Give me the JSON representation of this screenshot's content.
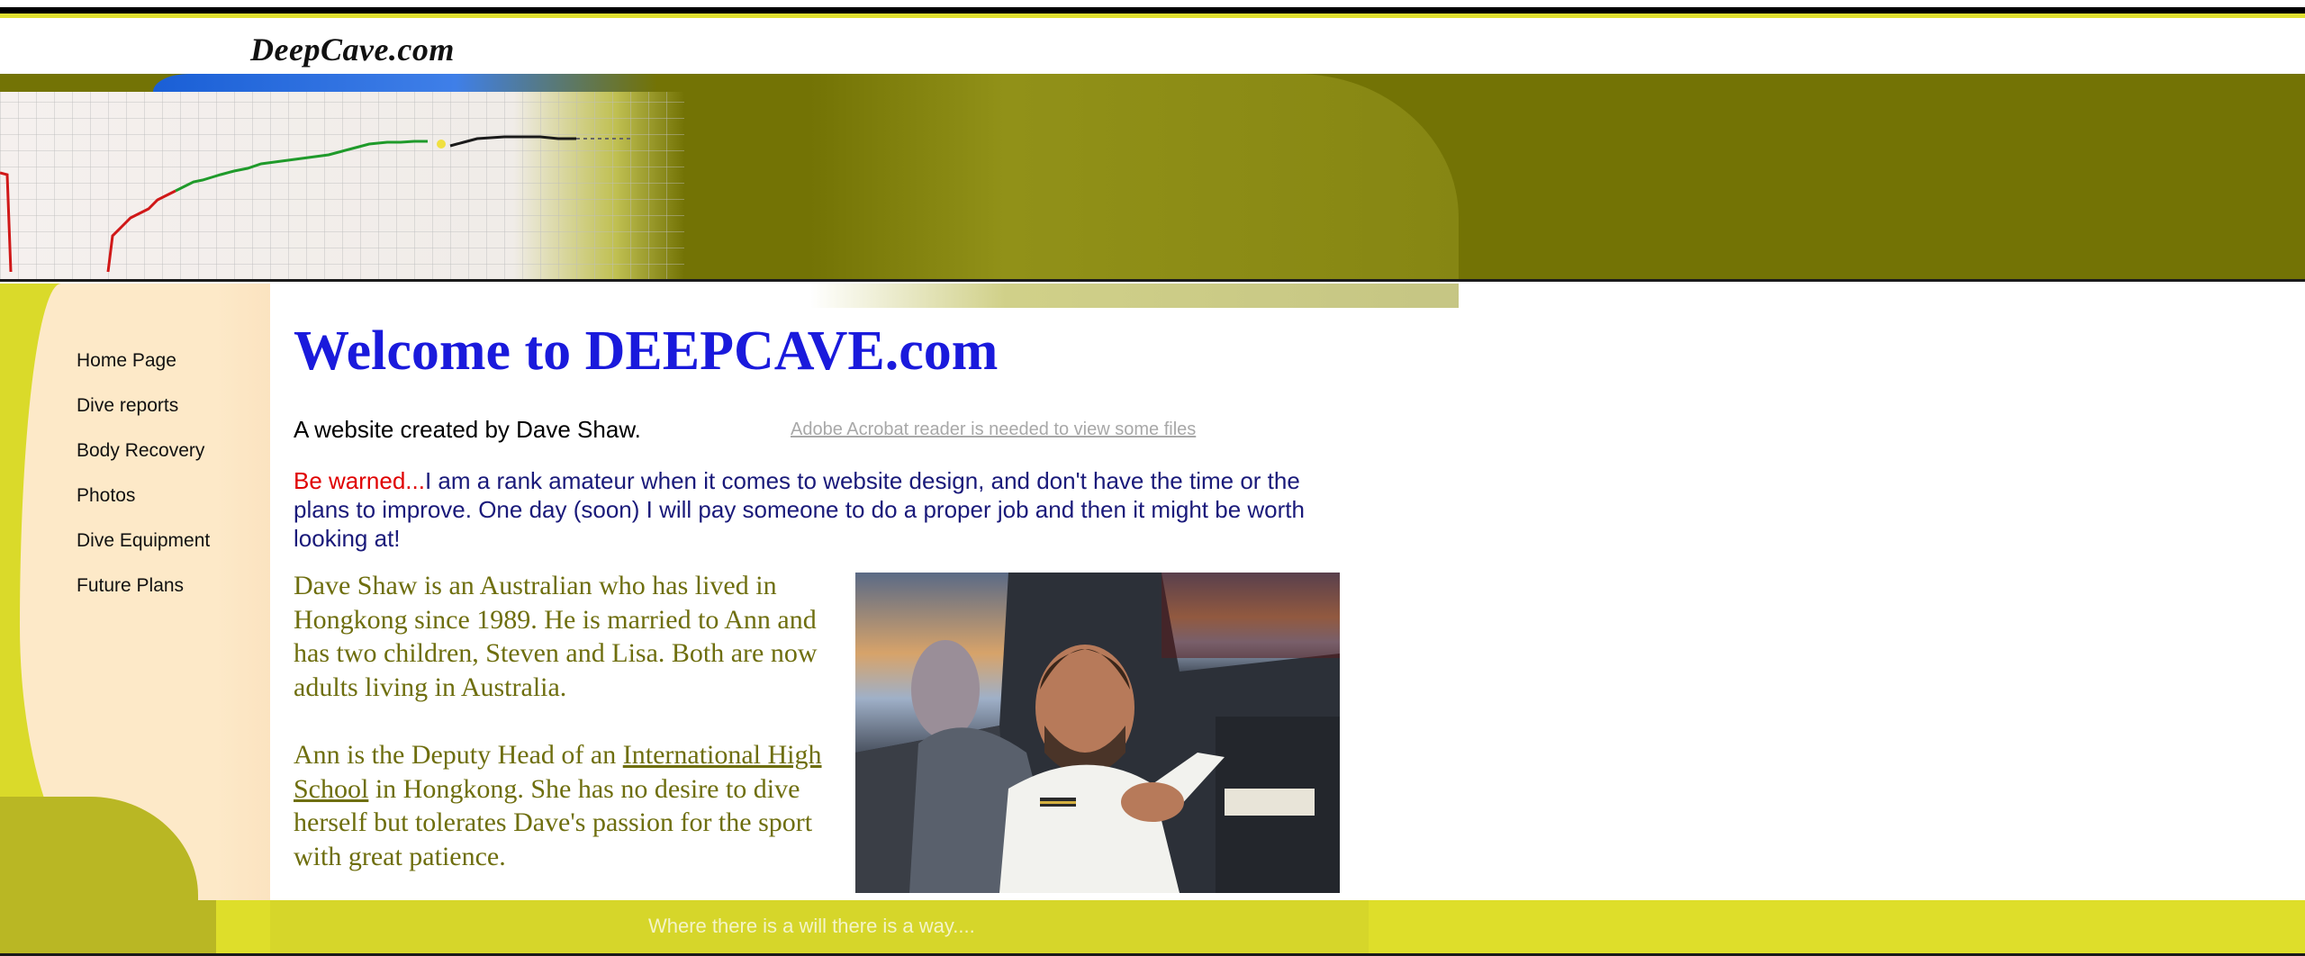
{
  "site": {
    "logo": "DeepCave.com"
  },
  "nav": {
    "items": [
      {
        "label": "Home Page"
      },
      {
        "label": "Dive reports"
      },
      {
        "label": "Body Recovery"
      },
      {
        "label": "Photos"
      },
      {
        "label": "Dive Equipment"
      },
      {
        "label": "Future Plans"
      }
    ]
  },
  "main": {
    "title": "Welcome to DEEPCAVE.com",
    "byline": "A website created by Dave Shaw.",
    "acrobat_link": "Adobe Acrobat reader is needed to view some files",
    "warning_lead": "Be warned...",
    "warning_text": "I am a rank amateur when it comes to website design, and don't have the time or the plans to improve.  One day (soon) I will pay someone to do a proper job and then it might be worth looking at!",
    "bio_p1": "Dave Shaw is an Australian who has lived in Hongkong since 1989.  He is married to Ann and has two children, Steven and Lisa.  Both are now adults living in Australia.",
    "bio_p2_before": "Ann is the Deputy Head of an ",
    "bio_p2_link": "International High School",
    "bio_p2_after": " in Hongkong.  She has no desire to dive herself but tolerates Dave's passion for the sport with great patience."
  },
  "footer": {
    "motto": "Where there is a will there is a way...."
  },
  "colors": {
    "title_blue": "#1a1adc",
    "warning_red": "#e00000",
    "body_navy": "#1a1a7a",
    "bio_olive": "#6e6e0e",
    "header_olive": "#737305",
    "footer_yellow": "#dede2a"
  }
}
